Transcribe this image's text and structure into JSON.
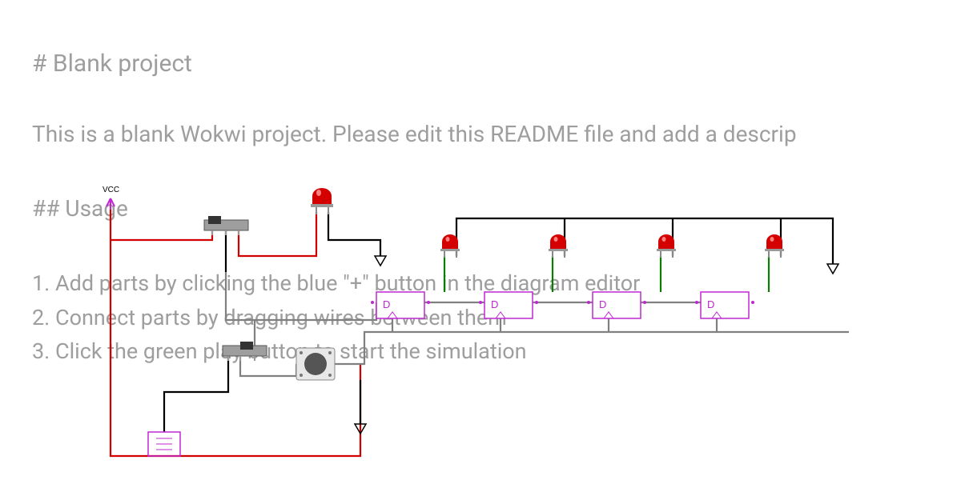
{
  "readme": {
    "title": "# Blank project",
    "lead": "This is a blank Wokwi project. Please edit this README file and add a descrip",
    "usage_heading": "## Usage",
    "steps": [
      "1. Add parts by clicking the blue \"+\" button in the diagram editor",
      "2. Connect parts by dragging wires between them",
      "3. Click the green play button to start the simulation"
    ]
  },
  "circuit": {
    "vcc_label": "VCC",
    "components": {
      "power_arrow": {
        "type": "vcc",
        "color": "#c026d3"
      },
      "switch1": {
        "type": "slide-switch"
      },
      "switch2": {
        "type": "slide-switch"
      },
      "pushbutton": {
        "type": "pushbutton"
      },
      "resistor": {
        "type": "resistor"
      },
      "led_top": {
        "type": "led",
        "color": "red"
      },
      "led1": {
        "type": "led",
        "color": "red"
      },
      "led2": {
        "type": "led",
        "color": "red"
      },
      "led3": {
        "type": "led",
        "color": "red"
      },
      "led4": {
        "type": "led",
        "color": "red"
      },
      "flipflop1": {
        "type": "d-flipflop",
        "label": "D"
      },
      "flipflop2": {
        "type": "d-flipflop",
        "label": "D"
      },
      "flipflop3": {
        "type": "d-flipflop",
        "label": "D"
      },
      "flipflop4": {
        "type": "d-flipflop",
        "label": "D"
      },
      "gnd1": {
        "type": "gnd"
      },
      "gnd2": {
        "type": "gnd"
      },
      "gnd3": {
        "type": "gnd"
      }
    },
    "wire_colors": {
      "vcc": "#d30000",
      "signal": "#000000",
      "clock": "#808080",
      "led_anode": "#0a7d00"
    }
  }
}
